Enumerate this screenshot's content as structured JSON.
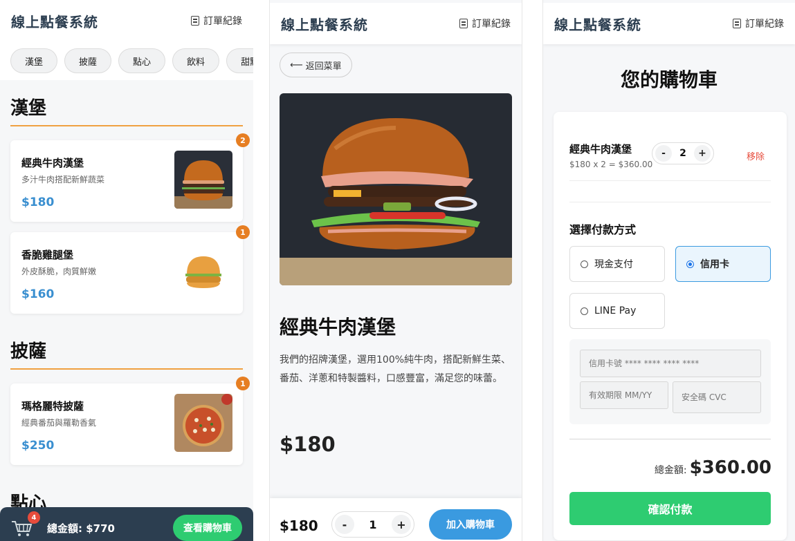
{
  "app": {
    "title": "線上點餐系統",
    "orders_label": "訂單紀錄"
  },
  "menu": {
    "categories": [
      "漢堡",
      "披薩",
      "點心",
      "飲料",
      "甜點"
    ],
    "sections": [
      {
        "title": "漢堡"
      },
      {
        "title": "披薩"
      },
      {
        "title": "點心"
      }
    ],
    "items": [
      {
        "name": "經典牛肉漢堡",
        "desc": "多汁牛肉搭配新鮮蔬菜",
        "price": "$180",
        "qty": "2"
      },
      {
        "name": "香脆雞腿堡",
        "desc": "外皮酥脆，肉質鮮嫩",
        "price": "$160",
        "qty": "1"
      },
      {
        "name": "瑪格麗特披薩",
        "desc": "經典番茄與羅勒香氣",
        "price": "$250",
        "qty": "1"
      }
    ],
    "cart_bar": {
      "count": "4",
      "total": "總金額: $770",
      "button": "查看購物車"
    }
  },
  "detail": {
    "back_label": "返回菜單",
    "name": "經典牛肉漢堡",
    "description": "我們的招牌漢堡，選用100%純牛肉，搭配新鮮生菜、番茄、洋蔥和特製醬料，口感豐富，滿足您的味蕾。",
    "price": "$180",
    "bottom_price": "$180",
    "qty": "1",
    "add_button": "加入購物車"
  },
  "cart": {
    "title": "您的購物車",
    "item": {
      "name": "經典牛肉漢堡",
      "sub": "$180 x 2 = $360.00",
      "qty": "2",
      "remove": "移除"
    },
    "payment_title": "選擇付款方式",
    "payment_options": [
      {
        "label": "現金支付",
        "selected": false
      },
      {
        "label": "信用卡",
        "selected": true
      },
      {
        "label": "LINE Pay",
        "selected": false
      }
    ],
    "card_number_placeholder": "信用卡號 **** **** **** ****",
    "expiry_placeholder": "有效期限 MM/YY",
    "cvc_placeholder": "安全碼 CVC",
    "total_label": "總金額:",
    "total_value": "$360.00",
    "confirm_button": "確認付款"
  },
  "stepper": {
    "minus": "-",
    "plus": "+"
  },
  "colors": {
    "accent_blue": "#3a9ae0",
    "accent_green": "#2ecc71",
    "accent_orange": "#e67e22",
    "dark_navy": "#2c3e50",
    "danger": "#e74c3c"
  },
  "icons": [
    "document-icon",
    "back-arrow-icon",
    "cart-icon"
  ]
}
